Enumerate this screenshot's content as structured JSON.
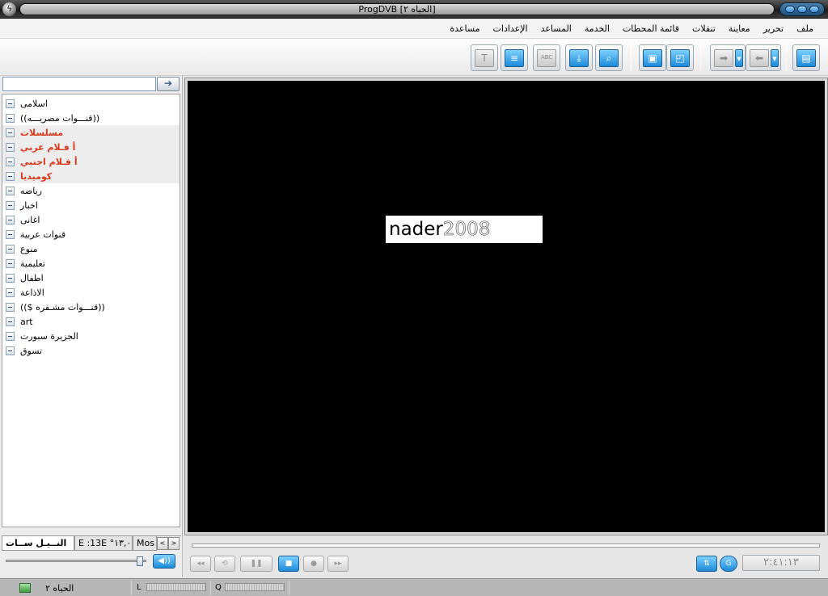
{
  "window": {
    "title": "ProgDVB [الحياه ٢]",
    "app_icon": "satellite-dish-icon",
    "controls": [
      "minimize-icon",
      "maximize-icon",
      "close-icon"
    ]
  },
  "menu": [
    "ملف",
    "تحرير",
    "معاينة",
    "تنقلات",
    "قائمة المحطات",
    "الخدمة",
    "المساعد",
    "الإعدادات",
    "مساعدة"
  ],
  "toolbar": {
    "buttons": [
      {
        "icon": "teletext-icon",
        "glyph": "T",
        "enabled": false
      },
      {
        "icon": "list-icon",
        "glyph": "≡",
        "enabled": true
      },
      {
        "icon": "subtitles-icon",
        "glyph": "ABC",
        "enabled": false
      },
      {
        "icon": "record-download-icon",
        "glyph": "⤓",
        "enabled": true
      },
      {
        "icon": "search-icon",
        "glyph": "⌕",
        "enabled": true
      },
      {
        "icon": "fullscreen-icon",
        "glyph": "▣",
        "enabled": true
      },
      {
        "icon": "window-mode-icon",
        "glyph": "◰",
        "enabled": true
      },
      {
        "icon": "forward-icon",
        "glyph": "➡",
        "enabled": false
      },
      {
        "icon": "back-icon",
        "glyph": "⬅",
        "enabled": false
      },
      {
        "icon": "channel-list-panel-icon",
        "glyph": "▤",
        "enabled": true
      }
    ]
  },
  "sidebar": {
    "search": {
      "value": "",
      "placeholder": ""
    },
    "go_glyph": "➔",
    "groups": [
      {
        "label": "اسلامى",
        "highlight": false
      },
      {
        "label": "((قنـــوات مصريـــه))",
        "highlight": false
      },
      {
        "label": "مسلسلات",
        "highlight": true
      },
      {
        "label": "أ فـلام عربي",
        "highlight": true
      },
      {
        "label": "أ فـلام اجنبي",
        "highlight": true
      },
      {
        "label": "كوميديا",
        "highlight": true
      },
      {
        "label": "رياضه",
        "highlight": false
      },
      {
        "label": "اخبار",
        "highlight": false
      },
      {
        "label": "اغانى",
        "highlight": false
      },
      {
        "label": "قنوات عربية",
        "highlight": false
      },
      {
        "label": "منوع",
        "highlight": false
      },
      {
        "label": "تعليمية",
        "highlight": false
      },
      {
        "label": "اطفال",
        "highlight": false
      },
      {
        "label": "الاذاعة",
        "highlight": false
      },
      {
        "label": "(($ قنـــوات مشـفره))",
        "highlight": false
      },
      {
        "label": "art",
        "highlight": false
      },
      {
        "label": "الجزيرة سبورت",
        "highlight": false
      },
      {
        "label": "تسوق",
        "highlight": false
      }
    ],
    "tabs": [
      {
        "label": "النــيـل ســات",
        "active": true
      },
      {
        "label": "E :13E °١٣,٠",
        "active": false
      },
      {
        "label": "Mos",
        "active": false
      }
    ],
    "tab_prev": "<",
    "tab_next": ">",
    "volume": {
      "level": 0.97,
      "button_glyph": "◀))"
    }
  },
  "video": {
    "logo_part1": "nader",
    "logo_part2": "2008"
  },
  "playback": {
    "progress": 0,
    "buttons": [
      {
        "icon": "previous-icon",
        "glyph": "◂◂",
        "enabled": false
      },
      {
        "icon": "rewind-icon",
        "glyph": "⟲",
        "enabled": false
      },
      {
        "icon": "pause-icon",
        "glyph": "❚❚",
        "enabled": false
      },
      {
        "icon": "stop-icon",
        "glyph": "■",
        "enabled": true
      },
      {
        "icon": "record-icon",
        "glyph": "●",
        "enabled": false
      },
      {
        "icon": "next-icon",
        "glyph": "▸▸",
        "enabled": false
      }
    ],
    "right_buttons": [
      {
        "icon": "audio-tracks-icon",
        "glyph": "⇅"
      },
      {
        "icon": "timeshift-icon",
        "glyph": "G"
      }
    ],
    "time": "٢:٤١:١٣"
  },
  "statusbar": {
    "channel_icon": "tv-icon",
    "channel": "الحياه ٢",
    "level_label": "L",
    "quality_label": "Q"
  }
}
